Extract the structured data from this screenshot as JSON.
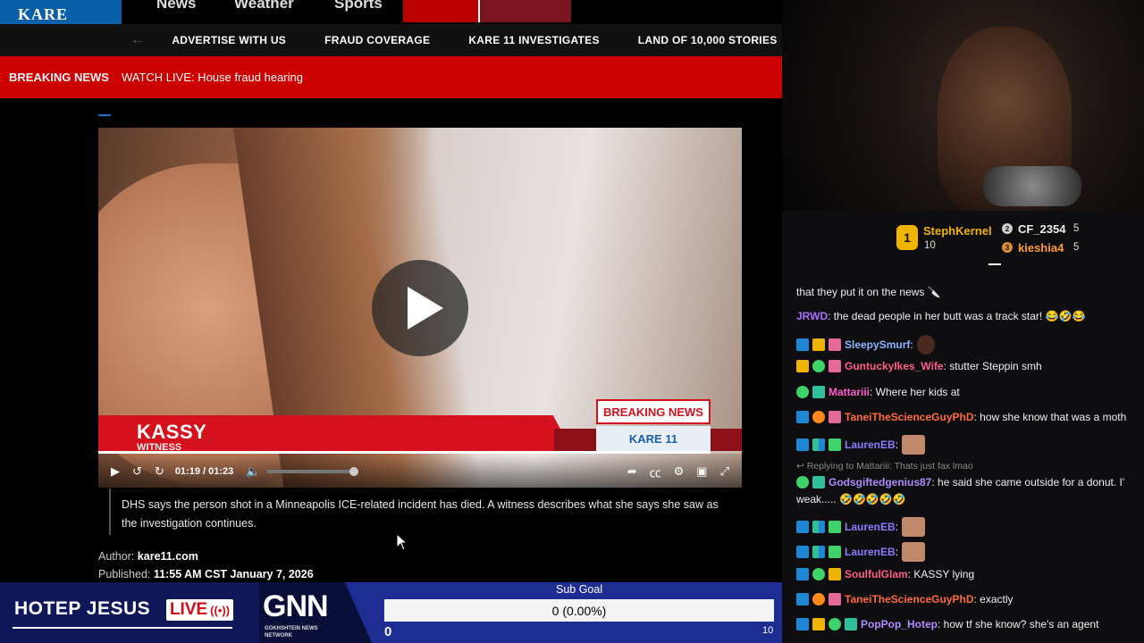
{
  "site": {
    "logo_text": "KARE",
    "top_nav": [
      "News",
      "Weather",
      "Sports"
    ],
    "secondary_nav": [
      "ADVERTISE WITH US",
      "FRAUD COVERAGE",
      "KARE 11 INVESTIGATES",
      "LAND OF 10,000 STORIES"
    ],
    "breaking_label": "BREAKING NEWS",
    "breaking_text": "WATCH LIVE: House fraud hearing"
  },
  "video": {
    "name_super": "KASSY",
    "name_sub": "WITNESS",
    "breaking_badge": "BREAKING NEWS",
    "station_badge": "KARE 11",
    "time_display": "01:19 / 01:23",
    "progress_fraction": 0.952
  },
  "article": {
    "caption": "DHS says the person shot in a Minneapolis ICE-related incident has died. A witness describes what she says she saw as the investigation continues.",
    "author_label": "Author:",
    "author_value": "kare11.com",
    "published_label": "Published:",
    "published_value": "11:55 AM CST January 7, 2026"
  },
  "overlay": {
    "show_title": "HOTEP JESUS",
    "live_label": "LIVE",
    "network_logo": "GNN",
    "network_sub": "GOKHSHTEIN NEWS NETWORK",
    "sub_goal_title": "Sub Goal",
    "sub_goal_value": "0 (0.00%)",
    "sub_goal_min": "0",
    "sub_goal_max": "10"
  },
  "leaderboard": {
    "first": {
      "name": "StephKernel",
      "count": "10"
    },
    "second": {
      "name": "CF_2354",
      "count": "5"
    },
    "third": {
      "name": "kieshia4",
      "count": "5"
    }
  },
  "chat": [
    {
      "user": "",
      "text": "that they put it on the news 🔪",
      "color": "#efeff1"
    },
    {
      "user": "JRWD",
      "text": ": the dead people in her butt was a track star! 😂🤣😂",
      "color": "#a970ff"
    },
    {
      "user": "SleepySmurf",
      "text": ":",
      "color": "#8ab4ff"
    },
    {
      "user": "GuntuckyIkes_Wife",
      "text": ": stutter Steppin smh",
      "color": "#ff5c8a"
    },
    {
      "user": "Mattariii",
      "text": ": Where her kids at",
      "color": "#ff5cc8"
    },
    {
      "user": "TaneiTheScienceGuyPhD",
      "text": ": how she know that was a moth",
      "color": "#ff6a3d"
    },
    {
      "user": "LaurenEB",
      "text": ":",
      "color": "#8a7bff"
    },
    {
      "user": "",
      "text": "↩ Replying to Mattariii: Thats just fax lmao",
      "color": "#8a8a8a"
    },
    {
      "user": "Godsgiftedgenius87",
      "text": ": he said she came outside for a donut. I'",
      "color": "#b08aff"
    },
    {
      "user": "",
      "text": "weak..... 🤣🤣🤣🤣🤣",
      "color": "#efeff1"
    },
    {
      "user": "LaurenEB",
      "text": ":",
      "color": "#8a7bff"
    },
    {
      "user": "LaurenEB",
      "text": ":",
      "color": "#8a7bff"
    },
    {
      "user": "SoulfulGlam",
      "text": ": KASSY lying",
      "color": "#ff5c8a"
    },
    {
      "user": "TaneiTheScienceGuyPhD",
      "text": ": exactly",
      "color": "#ff6a3d"
    },
    {
      "user": "PopPop_Hotep",
      "text": ": how tf she know? she's an agent",
      "color": "#b08aff"
    }
  ]
}
